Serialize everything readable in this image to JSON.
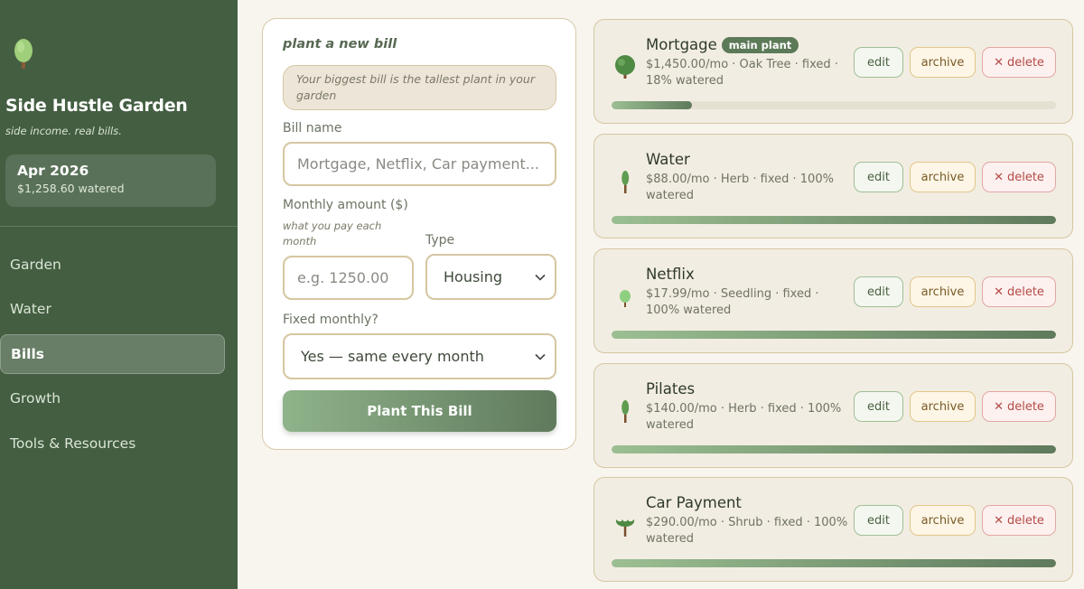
{
  "sidebar": {
    "title": "Side Hustle Garden",
    "subtitle": "side income. real bills.",
    "month_card": {
      "title": "Apr 2026",
      "subtitle": "$1,258.60 watered"
    },
    "nav": [
      {
        "label": "Garden",
        "active": false
      },
      {
        "label": "Water",
        "active": false
      },
      {
        "label": "Bills",
        "active": true
      },
      {
        "label": "Growth",
        "active": false
      },
      {
        "label": "Tools & Resources",
        "active": false
      }
    ]
  },
  "form": {
    "heading": "plant a new bill",
    "hint": "Your biggest bill is the tallest plant in your garden",
    "bill_name_label": "Bill name",
    "bill_name_placeholder": "Mortgage, Netflix, Car payment...",
    "amount_label": "Monthly amount ($)",
    "amount_sublabel": "what you pay each month",
    "amount_placeholder": "e.g. 1250.00",
    "type_label": "Type",
    "type_value": "Housing",
    "fixed_label": "Fixed monthly?",
    "fixed_value": "Yes — same every month",
    "submit_label": "Plant This Bill"
  },
  "bills": [
    {
      "name": "Mortgage",
      "badge": "main plant",
      "meta": "$1,450.00/mo · Oak Tree · fixed · 18% watered",
      "progress": 0.18,
      "plant": "tree-icon"
    },
    {
      "name": "Water",
      "badge": "",
      "meta": "$88.00/mo · Herb · fixed · 100% watered",
      "progress": 1.0,
      "plant": "herb-icon"
    },
    {
      "name": "Netflix",
      "badge": "",
      "meta": "$17.99/mo · Seedling · fixed · 100% watered",
      "progress": 1.0,
      "plant": "seedling-icon"
    },
    {
      "name": "Pilates",
      "badge": "",
      "meta": "$140.00/mo · Herb · fixed · 100% watered",
      "progress": 1.0,
      "plant": "herb-icon"
    },
    {
      "name": "Car Payment",
      "badge": "",
      "meta": "$290.00/mo · Shrub · fixed · 100% watered",
      "progress": 1.0,
      "plant": "shrub-icon"
    }
  ],
  "actions": {
    "edit": "edit",
    "archive": "archive",
    "delete": "delete"
  },
  "colors": {
    "sidebar_bg": "#435e41",
    "accent": "#5d7a58",
    "page_bg": "#f8f5ef"
  }
}
